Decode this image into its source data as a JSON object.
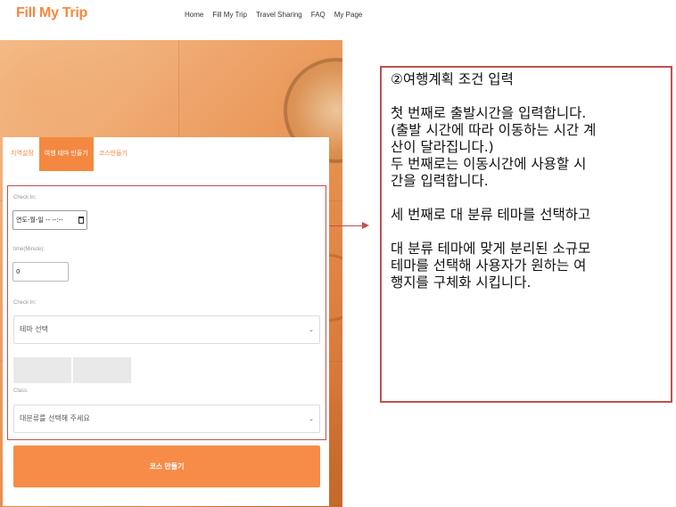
{
  "header": {
    "logo": "Fill My Trip",
    "nav": [
      "Home",
      "Fill My Trip",
      "Travel Sharing",
      "FAQ",
      "My Page"
    ]
  },
  "card": {
    "tabs": [
      "지역설정",
      "여행 테마 만들기",
      "코스만들기"
    ],
    "active_tab": 1,
    "checkin_label": "Check In:",
    "datetime_value": "연도-월-일 -- --:--",
    "time_label": "time(Minute):",
    "time_value": "0",
    "theme_label": "Check In:",
    "theme_select": "테마 선택",
    "class_label": "Class:",
    "class_select": "대분류를 선택해 주세요",
    "submit_label": "코스 만들기"
  },
  "annotation": {
    "title": "②여행계획 조건 입력",
    "lines": [
      "첫 번째로 출발시간을 입력합니다.",
      "(출발 시간에 따라 이동하는 시간 계",
      "산이 달라집니다.)",
      "두 번째로는 이동시간에 사용할 시",
      "간을 입력합니다."
    ],
    "line3": "세 번째로 대 분류 테마를 선택하고",
    "lines4": [
      "대 분류 테마에 맞게 분리된 소규모",
      "테마를 선택해 사용자가 원하는 여",
      "행지를 구체화 시킵니다."
    ]
  },
  "colors": {
    "accent": "#f48840",
    "annotation_border": "#c0504d"
  }
}
